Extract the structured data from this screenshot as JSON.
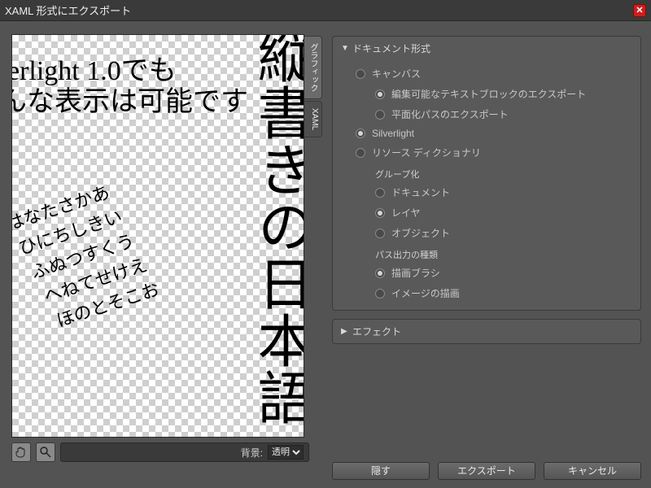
{
  "window": {
    "title": "XAML 形式にエクスポート"
  },
  "preview": {
    "line1": "erlight 1.0でも",
    "line2": "んな表示は可能です",
    "vertical": "縦書きの日本語",
    "script": "はなたさかあ\n ひにちしきい\n  ふぬつすくう\n   へねてせけえ\n    ほのとそこお"
  },
  "side_tabs": {
    "graphic": "グラフィック",
    "xaml": "XAML"
  },
  "bg": {
    "label": "背景:",
    "value": "透明"
  },
  "panels": {
    "doc": {
      "title": "ドキュメント形式",
      "canvas": "キャンバス",
      "canvas_opt1": "編集可能なテキストブロックのエクスポート",
      "canvas_opt2": "平面化パスのエクスポート",
      "silverlight": "Silverlight",
      "resourcedict": "リソース ディクショナリ",
      "group_title": "グループ化",
      "group_doc": "ドキュメント",
      "group_layer": "レイヤ",
      "group_object": "オブジェクト",
      "path_title": "パス出力の種類",
      "path_brush": "描画ブラシ",
      "path_image": "イメージの描画"
    },
    "effect": {
      "title": "エフェクト"
    }
  },
  "buttons": {
    "hide": "隠す",
    "export": "エクスポート",
    "cancel": "キャンセル"
  }
}
